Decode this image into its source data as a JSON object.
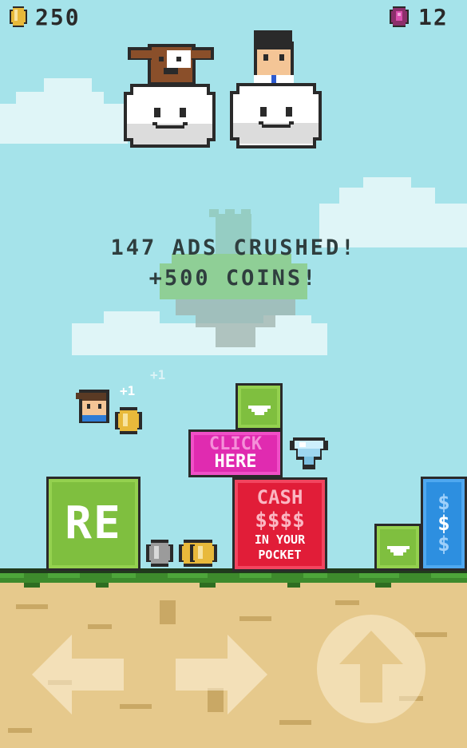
{
  "hud": {
    "coins": "250",
    "gems": "12",
    "coin_icon": "coin-icon",
    "gem_icon": "gem-icon"
  },
  "message": {
    "line1": "147 ADS CRUSHED!",
    "line2": "+500 COINS!"
  },
  "floating_bonus": {
    "near_player": "+1",
    "upper": "+1"
  },
  "ads": {
    "click_here_line1": "CLICK",
    "click_here_line2": "HERE",
    "cash_title": "CASH",
    "cash_dollars": "$$$$",
    "cash_line3": "IN YOUR",
    "cash_line4": "POCKET",
    "re_label": "RE",
    "blue_dollars": "$"
  },
  "controls": {
    "left": "left-arrow-icon",
    "right": "right-arrow-icon",
    "jump": "up-arrow-icon"
  },
  "colors": {
    "sky": "#a5e3ea",
    "ground": "#e6c98c",
    "grass": "#3d8a2c",
    "green_ad": "#7fbf3f",
    "pink_ad": "#e02bb0",
    "red_ad": "#e11d38",
    "blue_ad": "#2d8fe0"
  }
}
